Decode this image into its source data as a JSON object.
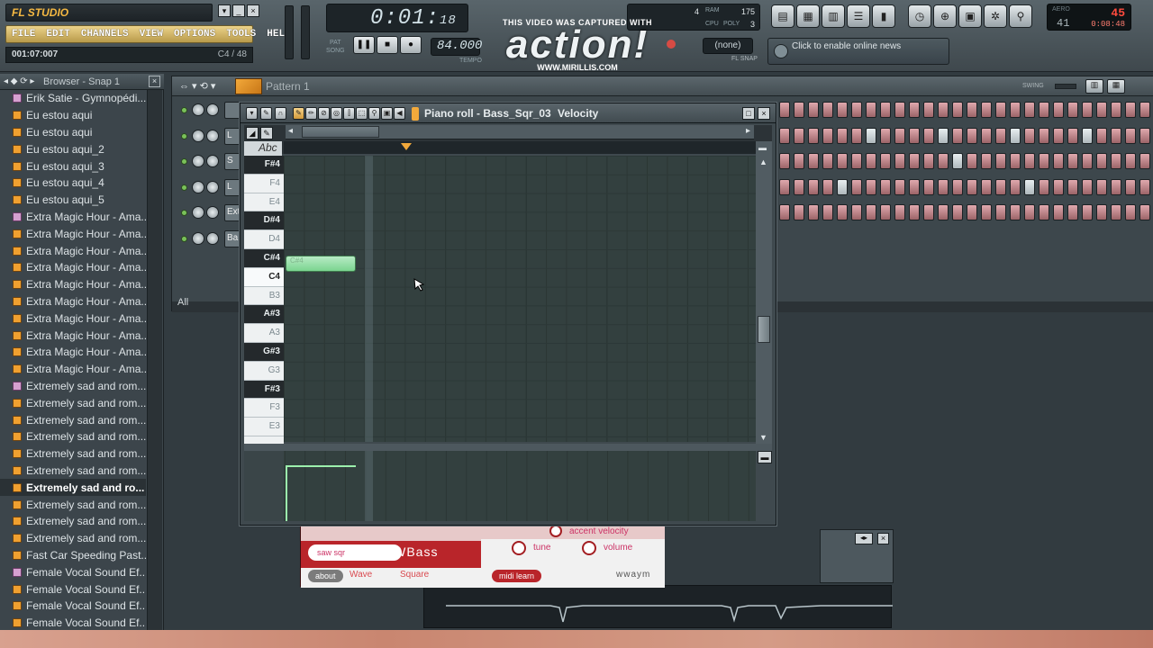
{
  "app": {
    "title": "FL STUDIO"
  },
  "menu": [
    "FILE",
    "EDIT",
    "CHANNELS",
    "VIEW",
    "OPTIONS",
    "TOOLS",
    "HELP"
  ],
  "hint": {
    "time": "001:07:007",
    "position": "C4 / 48"
  },
  "transport": {
    "time_main": "0:01:",
    "time_sub": "18",
    "pat_label": "PAT",
    "song_label": "SONG",
    "tempo": "84.000",
    "tempo_label": "TEMPO"
  },
  "watermark": {
    "line1": "THIS VIDEO WAS CAPTURED WITH",
    "line2": "action!",
    "line3": "WWW.MIRILLIS.COM"
  },
  "cpu": {
    "v1": "4",
    "v2": "175",
    "v3": "3",
    "l1": "RAM",
    "l2": "CPU",
    "l3": "POLY"
  },
  "snap": {
    "value": "(none)",
    "label": "FL SNAP"
  },
  "news": {
    "text": "Click to enable online news"
  },
  "clock": {
    "label": "AERO",
    "top": "45",
    "left": "41",
    "time": "0:08:48"
  },
  "browser": {
    "title": "Browser - Snap 1",
    "items": [
      {
        "label": "Erik Satie - Gymnopédi...",
        "type": "pk"
      },
      {
        "label": "Eu estou aqui",
        "type": "wav"
      },
      {
        "label": "Eu estou aqui",
        "type": "wav"
      },
      {
        "label": "Eu estou aqui_2",
        "type": "wav"
      },
      {
        "label": "Eu estou aqui_3",
        "type": "wav"
      },
      {
        "label": "Eu estou aqui_4",
        "type": "wav"
      },
      {
        "label": "Eu estou aqui_5",
        "type": "wav"
      },
      {
        "label": "Extra Magic Hour - Ama...",
        "type": "pk"
      },
      {
        "label": "Extra Magic Hour - Ama...",
        "type": "wav"
      },
      {
        "label": "Extra Magic Hour - Ama...",
        "type": "wav"
      },
      {
        "label": "Extra Magic Hour - Ama...",
        "type": "wav"
      },
      {
        "label": "Extra Magic Hour - Ama...",
        "type": "wav"
      },
      {
        "label": "Extra Magic Hour - Ama...",
        "type": "wav"
      },
      {
        "label": "Extra Magic Hour - Ama...",
        "type": "wav"
      },
      {
        "label": "Extra Magic Hour - Ama...",
        "type": "wav"
      },
      {
        "label": "Extra Magic Hour - Ama...",
        "type": "wav"
      },
      {
        "label": "Extra Magic Hour - Ama...",
        "type": "wav"
      },
      {
        "label": "Extremely sad and rom...",
        "type": "pk"
      },
      {
        "label": "Extremely sad and rom...",
        "type": "wav"
      },
      {
        "label": "Extremely sad and rom...",
        "type": "wav"
      },
      {
        "label": "Extremely sad and rom...",
        "type": "wav"
      },
      {
        "label": "Extremely sad and rom...",
        "type": "wav"
      },
      {
        "label": "Extremely sad and rom...",
        "type": "wav"
      },
      {
        "label": "Extremely sad and ro...",
        "type": "wav",
        "selected": true
      },
      {
        "label": "Extremely sad and rom...",
        "type": "wav"
      },
      {
        "label": "Extremely sad and rom...",
        "type": "wav"
      },
      {
        "label": "Extremely sad and rom...",
        "type": "wav"
      },
      {
        "label": "Fast Car Speeding Past...",
        "type": "wav"
      },
      {
        "label": "Female Vocal Sound Ef...",
        "type": "pk"
      },
      {
        "label": "Female Vocal Sound Ef...",
        "type": "wav"
      },
      {
        "label": "Female Vocal Sound Ef...",
        "type": "wav"
      },
      {
        "label": "Female Vocal Sound Ef...",
        "type": "wav"
      }
    ]
  },
  "rack": {
    "pattern": "Pattern 1",
    "swing": "SWING",
    "filter": "All",
    "channels": [
      "",
      "L",
      "S",
      "L",
      "Ext",
      "Ba"
    ]
  },
  "piano_roll": {
    "title": "Piano roll - Bass_Sqr_03",
    "mode": "Velocity",
    "abc": "Abc",
    "keys": [
      "F#4",
      "F4",
      "E4",
      "D#4",
      "D4",
      "C#4",
      "C4",
      "B3",
      "A#3",
      "A3",
      "G#3",
      "G3",
      "F#3",
      "F3",
      "E3"
    ],
    "note": {
      "key": "C#4",
      "label": "C#4"
    }
  },
  "plugin": {
    "name": "NWBass",
    "wave_options": "saw  sqr",
    "about": "about",
    "wave": "Wave",
    "square": "Square",
    "midi_learn": "midi learn",
    "brand": "wwaym",
    "accent_velocity": "accent velocity",
    "tune": "tune",
    "volume": "volume"
  },
  "colors": {
    "accent": "#f2a93b",
    "note": "#8fe0a2",
    "plugin_red": "#b9252a"
  }
}
